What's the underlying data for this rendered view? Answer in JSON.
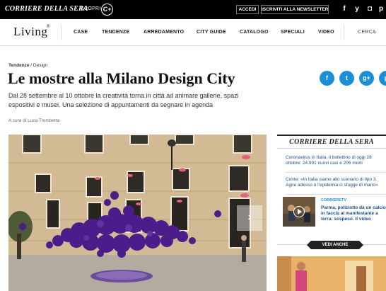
{
  "topbar": {
    "brand": "CORRIERE DELLA SERA",
    "scopri": "SCOPRI",
    "cplus": "C+",
    "accedi": "ACCEDI",
    "newsletter": "ISCRIVITI ALLA NEWSLETTER",
    "social": [
      "f",
      "y",
      "◘",
      "p"
    ]
  },
  "nav": {
    "logo": "Living",
    "items": [
      "CASE",
      "TENDENZE",
      "ARREDAMENTO",
      "CITY GUIDE",
      "CATALOGO",
      "SPECIALI",
      "VIDEO"
    ],
    "search": "CERCA"
  },
  "article": {
    "breadcrumb_section": "Tendenze",
    "breadcrumb_sep": " / ",
    "breadcrumb_sub": "Design",
    "title": "Le mostre alla Milano Design City",
    "subtitle": "Dal 28 settembre al 10 ottobre la creatività torna in città ad animare gallerie, spazi espositivi e musei. Una selezione di appuntamenti da segnare in agenda",
    "author": "A cura di Luca Trombetta",
    "share": [
      "f",
      "t",
      "g+",
      "p"
    ],
    "hero_next": "›"
  },
  "sidebar": {
    "brand": "CORRIERE DELLA SERA",
    "news": [
      "Coronavirus in Italia, il bollettino di oggi 28 ottobre: 24.991 nuovi casi e 205 morti",
      "Conte: «In Italia siamo allo scenario di tipo 3. Agire adesso o l'epidemia ci sfugge di mano»"
    ],
    "tv_label": "CORRIERETV",
    "tv_text": "Parma, poliziotto dà un calcio in faccia al manifestante a terra: sospeso. Il video",
    "vedi_anche": "VEDI ANCHE"
  },
  "colors": {
    "accent": "#1a8fd8",
    "link": "#1a4c8c",
    "topbar": "#000000",
    "balloons": "#4b1d8a"
  }
}
